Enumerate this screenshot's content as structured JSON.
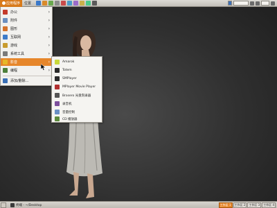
{
  "top_panel": {
    "start_label": "应用程序",
    "places_label": "位置",
    "clock": "10:51"
  },
  "menu": {
    "items": [
      {
        "label": "办公",
        "icon_color": "#c43a2a"
      },
      {
        "label": "附件",
        "icon_color": "#6b8fbf"
      },
      {
        "label": "图形",
        "icon_color": "#d4722a"
      },
      {
        "label": "互联网",
        "icon_color": "#3d7cc9"
      },
      {
        "label": "游戏",
        "icon_color": "#c89b2e"
      },
      {
        "label": "系统工具",
        "icon_color": "#7a7a7a"
      },
      {
        "label": "影音",
        "icon_color": "#e6b82a"
      },
      {
        "label": "编程",
        "icon_color": "#4d7f3a"
      },
      {
        "label": "添加/删除...",
        "icon_color": "#3a6fb5"
      }
    ],
    "active_index": 6
  },
  "submenu": {
    "items": [
      {
        "label": "Amarok",
        "icon_color": "#c8d83a"
      },
      {
        "label": "Totem",
        "icon_color": "#2a2a2a"
      },
      {
        "label": "SMPlayer",
        "icon_color": "#2b2b2b"
      },
      {
        "label": "MPlayer Movie Player",
        "icon_color": "#b23030"
      },
      {
        "label": "Brasero 光盘刻录器",
        "icon_color": "#555555"
      },
      {
        "label": "录音机",
        "icon_color": "#7c4f9c"
      },
      {
        "label": "音量控制",
        "icon_color": "#6a8fc4"
      },
      {
        "label": "CD 播放器",
        "icon_color": "#5c8a3c"
      }
    ]
  },
  "bottom_panel": {
    "task_label": "终端 - ~/Desktop",
    "workspaces": [
      "工作区 1",
      "工作区 2",
      "工作区 3",
      "工作区 4"
    ],
    "active_workspace": 0
  },
  "colors": {
    "accent": "#e6862a",
    "panel": "#d3d0ca",
    "desktop": "#3a3a3a"
  }
}
